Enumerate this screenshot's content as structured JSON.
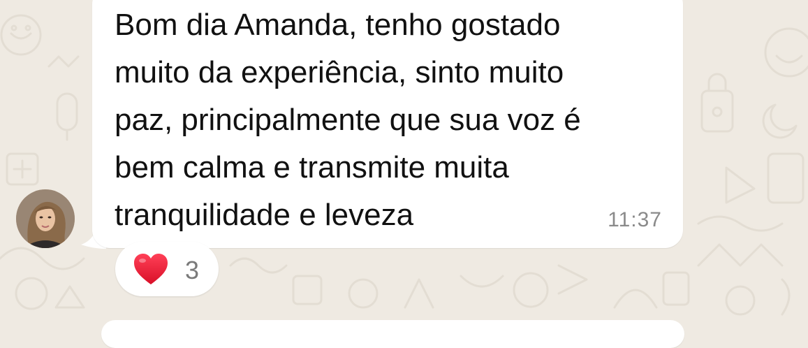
{
  "colors": {
    "chat_background": "#efeae2",
    "bubble_background": "#ffffff",
    "message_text": "#111111",
    "timestamp_text": "#8a8a8a",
    "reaction_heart": "#e8112d"
  },
  "message": {
    "text": "Bom dia Amanda, tenho gostado\nmuito da experiência, sinto muito\npaz, principalmente que sua voz é\nbem calma e transmite muita\ntranquilidade e leveza",
    "time": "11:37",
    "sender_avatar_icon": "avatar"
  },
  "reaction": {
    "icon": "heart-icon",
    "count": "3"
  }
}
